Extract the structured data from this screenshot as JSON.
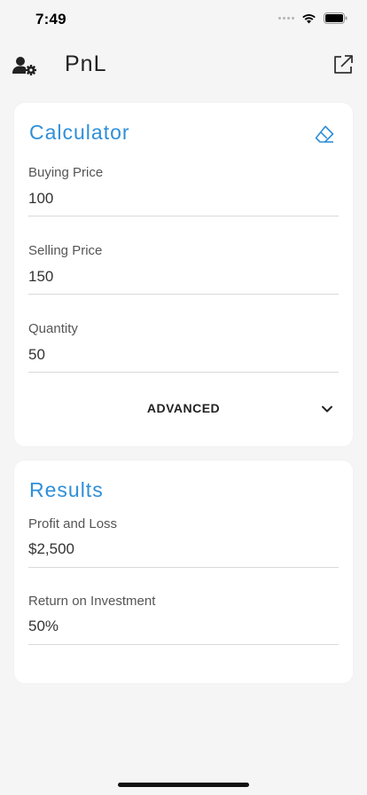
{
  "status_bar": {
    "time": "7:49"
  },
  "header": {
    "title": "PnL",
    "profile_icon": "user-settings-icon",
    "share_icon": "external-link-icon"
  },
  "calculator": {
    "title": "Calculator",
    "clear_icon": "eraser-icon",
    "buying_price": {
      "label": "Buying Price",
      "value": "100"
    },
    "selling_price": {
      "label": "Selling Price",
      "value": "150"
    },
    "quantity": {
      "label": "Quantity",
      "value": "50"
    },
    "advanced_label": "ADVANCED"
  },
  "results": {
    "title": "Results",
    "profit_and_loss": {
      "label": "Profit and Loss",
      "value": "$2,500"
    },
    "return_on_investment": {
      "label": "Return on Investment",
      "value": "50%"
    }
  },
  "colors": {
    "accent": "#2f8fd8",
    "background": "#f5f5f5",
    "card": "#ffffff"
  }
}
